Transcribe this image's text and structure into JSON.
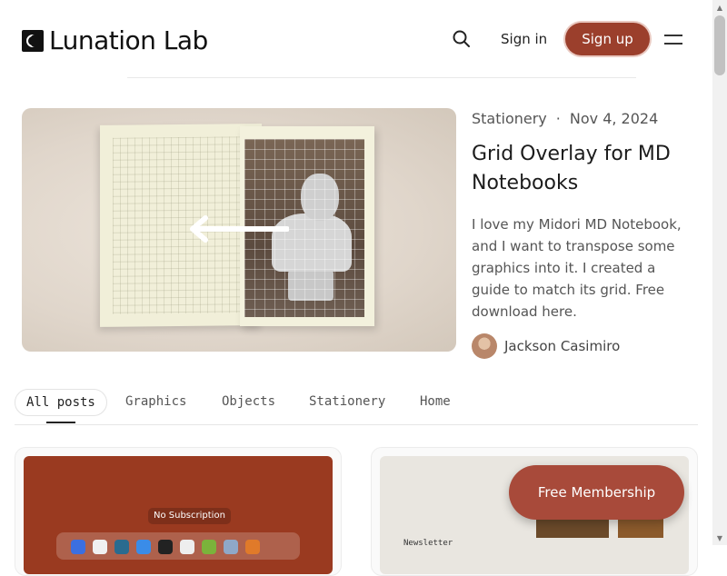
{
  "header": {
    "logo_text": "Lunation Lab",
    "signin_label": "Sign in",
    "signup_label": "Sign up",
    "icons": [
      "search-icon",
      "menu-icon"
    ]
  },
  "hero": {
    "category": "Stationery",
    "separator": "·",
    "date": "Nov 4, 2024",
    "title": "Grid Overlay for MD Notebooks",
    "excerpt": "I love my Midori MD Notebook, and I want to transpose some graphics into it. I created a guide to match its grid. Free download here.",
    "author": "Jackson Casimiro"
  },
  "tabs": {
    "items": [
      {
        "label": "All posts",
        "active": true
      },
      {
        "label": "Graphics"
      },
      {
        "label": "Objects"
      },
      {
        "label": "Stationery"
      },
      {
        "label": "Home"
      }
    ]
  },
  "cards": {
    "card_a": {
      "overlay_label": "No Subscription"
    },
    "card_b": {
      "label": "Newsletter"
    }
  },
  "cta": {
    "membership_label": "Free Membership"
  },
  "colors": {
    "accent": "#9b3f2c",
    "membership": "#a84a3a"
  }
}
